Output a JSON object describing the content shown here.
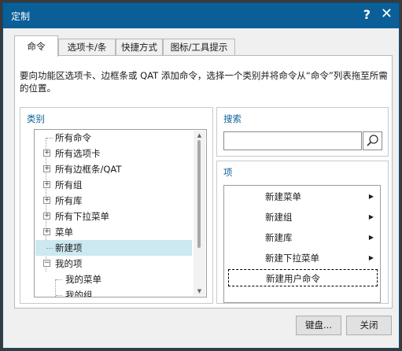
{
  "window": {
    "title": "定制",
    "help": "?",
    "close": "✕"
  },
  "tabs": [
    "命令",
    "选项卡/条",
    "快捷方式",
    "图标/工具提示"
  ],
  "description": "要向功能区选项卡、边框条或 QAT 添加命令，选择一个类别并将命令从“命令”列表拖至所需的位置。",
  "category": {
    "title": "类别",
    "items": [
      {
        "label": "所有命令",
        "expander": "",
        "selected": false
      },
      {
        "label": "所有选项卡",
        "expander": "+",
        "selected": false
      },
      {
        "label": "所有边框条/QAT",
        "expander": "+",
        "selected": false
      },
      {
        "label": "所有组",
        "expander": "+",
        "selected": false
      },
      {
        "label": "所有库",
        "expander": "+",
        "selected": false
      },
      {
        "label": "所有下拉菜单",
        "expander": "+",
        "selected": false
      },
      {
        "label": "菜单",
        "expander": "+",
        "selected": false
      },
      {
        "label": "新建项",
        "expander": "",
        "selected": true
      },
      {
        "label": "我的项",
        "expander": "−",
        "selected": false
      },
      {
        "label": "我的菜单",
        "expander": "",
        "selected": false
      },
      {
        "label": "我的组",
        "expander": "",
        "selected": false
      }
    ]
  },
  "search": {
    "title": "搜索",
    "value": "",
    "placeholder": ""
  },
  "items": {
    "title": "项",
    "list": [
      {
        "label": "新建菜单",
        "arrow": "▶"
      },
      {
        "label": "新建组",
        "arrow": "▶"
      },
      {
        "label": "新建库",
        "arrow": "▶"
      },
      {
        "label": "新建下拉菜单",
        "arrow": "▶"
      },
      {
        "label": "新建用户命令",
        "arrow": ""
      }
    ]
  },
  "buttons": {
    "keyboard": "键盘...",
    "close": "关闭"
  }
}
